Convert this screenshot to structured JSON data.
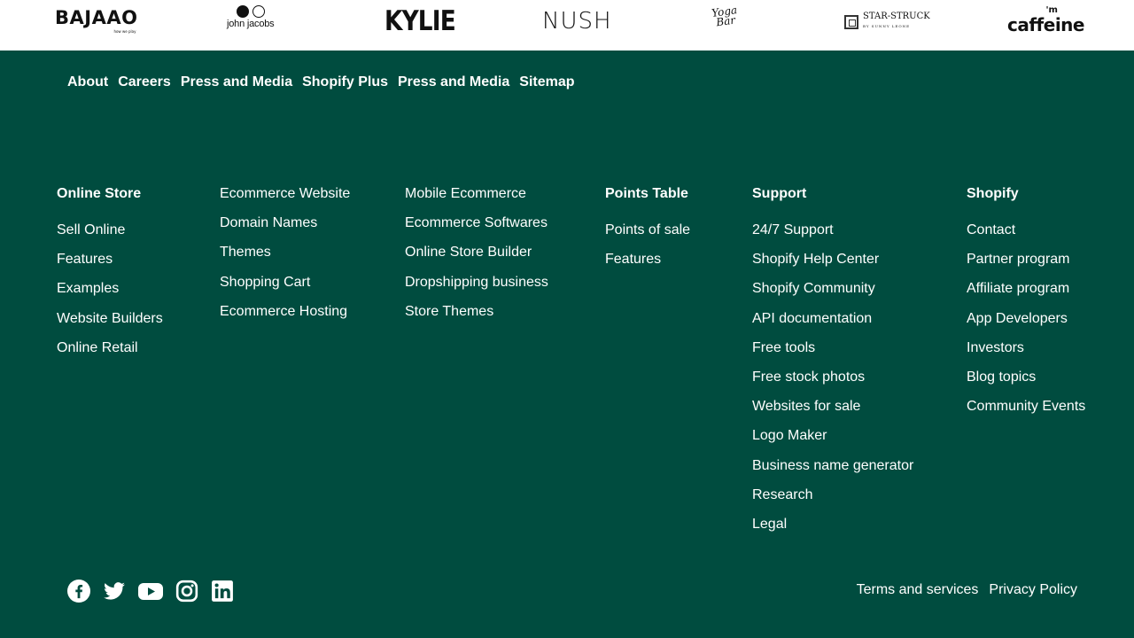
{
  "brands": {
    "bajaao": "BAJAAO",
    "bajaao_tag": "how we play",
    "john_jacobs": "john jacobs",
    "kylie": "KYLIE",
    "nush": "NUSH",
    "yogabar_1": "Yoga",
    "yogabar_2": "Bar",
    "starstruck": "STAR-STRUCK",
    "starstruck_tag": "BY SUNNY LEONE",
    "mcaffeine_im": "'m",
    "mcaffeine": "caffeine"
  },
  "top_links": [
    "About",
    "Careers",
    "Press and Media",
    "Shopify Plus",
    "Press and Media",
    "Sitemap"
  ],
  "columns": {
    "online_store": {
      "heading": "Online Store",
      "items": [
        "Sell Online",
        "Features",
        "Examples",
        "Website Builders",
        "Online Retail"
      ]
    },
    "online_store_2": {
      "items": [
        "Ecommerce Website",
        "Domain Names",
        "Themes",
        "Shopping Cart",
        "Ecommerce Hosting"
      ]
    },
    "online_store_3": {
      "items": [
        "Mobile Ecommerce",
        "Ecommerce Softwares",
        "Online Store Builder",
        "Dropshipping business",
        "Store Themes"
      ]
    },
    "points_table": {
      "heading": "Points Table",
      "items": [
        "Points of sale",
        "Features"
      ]
    },
    "support": {
      "heading": "Support",
      "items": [
        "24/7 Support",
        "Shopify Help Center",
        "Shopify Community",
        "API documentation",
        "Free tools",
        "Free stock photos",
        "Websites for sale",
        "Logo Maker",
        "Business name generator",
        "Research",
        "Legal"
      ]
    },
    "shopify": {
      "heading": "Shopify",
      "items": [
        "Contact",
        "Partner program",
        "Affiliate program",
        "App Developers",
        "Investors",
        "Blog topics",
        "Community Events"
      ]
    }
  },
  "social_icons": [
    "facebook-icon",
    "twitter-icon",
    "youtube-icon",
    "instagram-icon",
    "linkedin-icon"
  ],
  "legal_links": [
    "Terms and services",
    "Privacy Policy"
  ],
  "colors": {
    "footer_bg": "#004c3f",
    "text": "#ffffff"
  }
}
